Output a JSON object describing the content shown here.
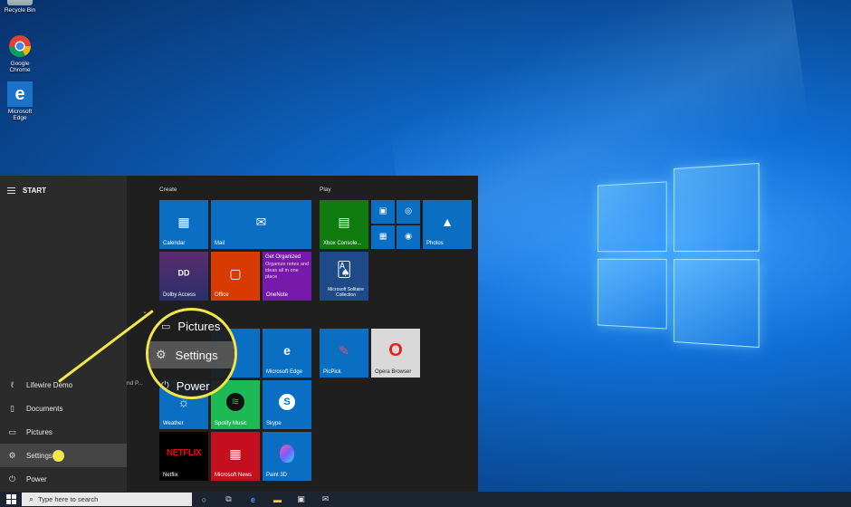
{
  "desktop": {
    "icons": [
      {
        "label": "Recycle Bin"
      },
      {
        "label": "Google Chrome"
      },
      {
        "label": "Microsoft Edge"
      }
    ]
  },
  "start_menu": {
    "header": "START",
    "rail": [
      {
        "label": "Lifewire Demo",
        "icon": "user-icon"
      },
      {
        "label": "Documents",
        "icon": "document-icon"
      },
      {
        "label": "Pictures",
        "icon": "picture-icon"
      },
      {
        "label": "Settings",
        "icon": "gear-icon"
      },
      {
        "label": "Power",
        "icon": "power-icon"
      }
    ],
    "groups": {
      "create": "Create",
      "play": "Play"
    },
    "tiles": {
      "calendar": "Calendar",
      "mail": "Mail",
      "dolby": "Dolby Access",
      "office": "Office",
      "onenote_title": "Get Organized",
      "onenote_sub": "Organize notes and ideas all in one place",
      "onenote": "OneNote",
      "xbox": "Xbox Console...",
      "photos": "Photos",
      "solitaire": "Microsoft Solitaire Collection",
      "edge": "Microsoft Edge",
      "picpick": "PicPick",
      "opera": "Opera Browser",
      "weather": "Weather",
      "spotify": "Spotify Music",
      "skype": "Skype",
      "netflix": "Netflix",
      "news": "Microsoft News",
      "paint3d": "Paint 3D"
    },
    "callout": {
      "pictures": "Pictures",
      "settings": "Settings",
      "power": "Power"
    },
    "partial_text": "nd P..."
  },
  "taskbar": {
    "search_placeholder": "Type here to search"
  },
  "colors": {
    "accent": "#0a6fc2",
    "callout": "#f2e64a",
    "office": "#d83b01",
    "onenote": "#7719aa",
    "spotify": "#1db954",
    "netflix": "#000000",
    "news": "#c50f1f"
  }
}
